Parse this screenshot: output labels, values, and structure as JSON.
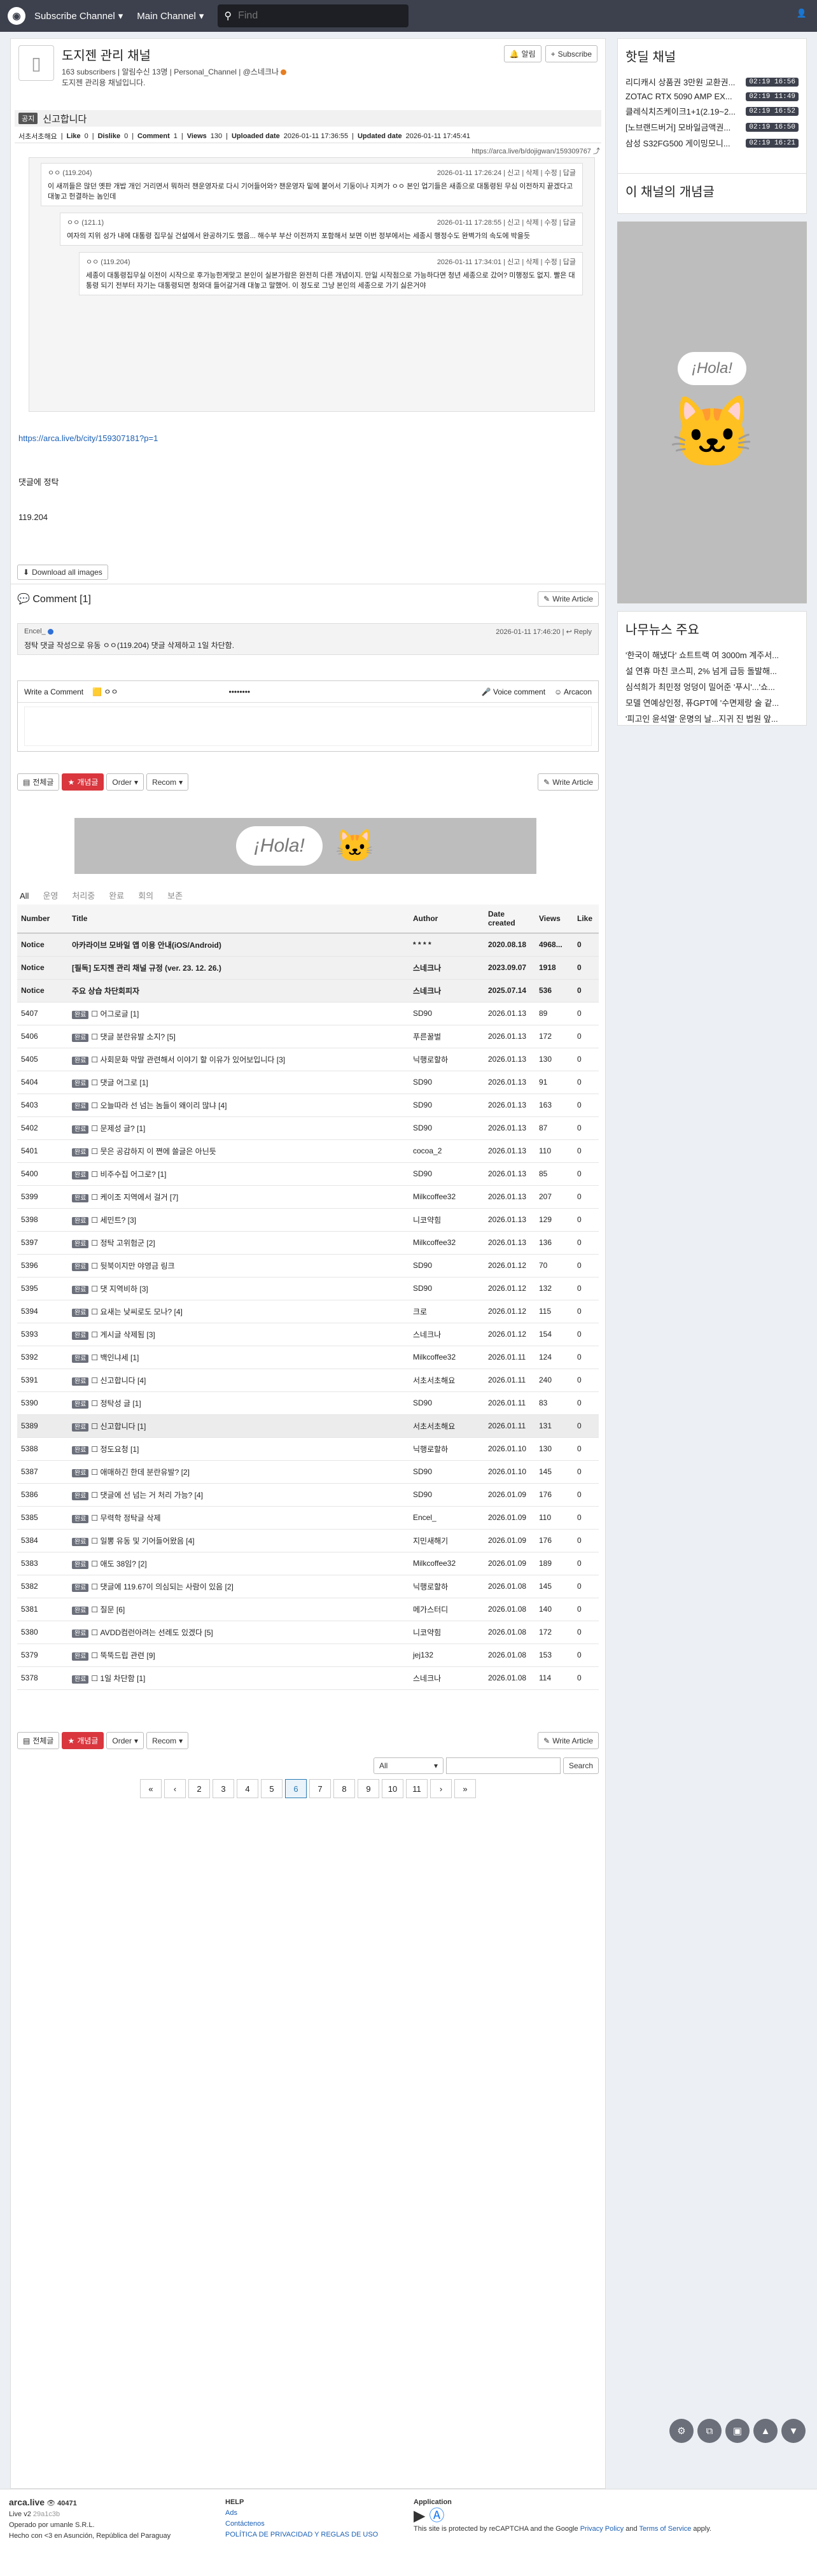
{
  "nav": {
    "subscribe": "Subscribe Channel",
    "main": "Main Channel",
    "search_placeholder": "Find"
  },
  "channel": {
    "name": "도지젠 관리 채널",
    "subs": "163 subscribers",
    "alert": "알림수신 13명",
    "type": "Personal_Channel",
    "owner": "@스네크나",
    "desc": "도지젠 관리용 채널입니다.",
    "notify": "알림",
    "subscribe": "Subscribe"
  },
  "article": {
    "cat": "공지",
    "title": "신고합니다",
    "author": "서초서초해요",
    "like_lbl": "Like",
    "like": "0",
    "dislike_lbl": "Dislike",
    "dislike": "0",
    "comment_lbl": "Comment",
    "comment": "1",
    "views_lbl": "Views",
    "views": "130",
    "up_lbl": "Uploaded date",
    "up": "2026-01-11 17:36:55",
    "upd_lbl": "Updated date",
    "upd": "2026-01-11 17:45:41",
    "link": "https://arca.live/b/dojigwan/159309767"
  },
  "quote": [
    {
      "who": "ㅇㅇ (119.204)",
      "time": "2026-01-11 17:26:24",
      "acts": "신고 | 삭제 | 수정 | 답글",
      "text": "이 새끼들은 많던 옛판 개밥 개인 거리면서 뭐하러 챈운영자로 다시 기어들어와? 챈운영자 밑에 붙어서 기둥이나 지켜가 ㅇㅇ 본인 업기들은 새종으로 대통령된 무심 이전하지 끝겠다고 대놓고 헌결하는 놈인데"
    },
    {
      "who": "ㅇㅇ (121.1)",
      "time": "2026-01-11 17:28:55",
      "acts": "신고 | 삭제 | 수정 | 답글",
      "text": "여자의 지위 성가 내에 대통령 집무실 건설에서 완공하기도 했음... 해수부 부산 이전까지 포함해서 보면 이번 정부에서는 세종시 행정수도 완벽가의 속도에 박을듯"
    },
    {
      "who": "ㅇㅇ (119.204)",
      "time": "2026-01-11 17:34:01",
      "acts": "신고 | 삭제 | 수정 | 답글",
      "text": "세종이 대통령집무실 이전이 시작으로 후가능한게맞고 본인이 실본가람은 완전히 다른 개념이지. 만일 시작점으로 가능하다면 청년 세종으로 갔어? 미행정도 없지. 빨은 대통령 되기 전부터 자기는 대통령되면 청와대 들어갈거래 대놓고 말했어. 이 정도로 그냥 본인의 세종으로 가기 싫은거야"
    }
  ],
  "body": {
    "link": "https://arca.live/b/city/159307181?p=1",
    "line1": "댓글에 정탁",
    "line2": "119.204"
  },
  "download": "Download all images",
  "comments": {
    "title": "Comment [1]",
    "write": "Write Article",
    "author": "Encel_",
    "time": "2026-01-11 17:46:20",
    "reply": "Reply",
    "text": "정탁 댓글 작성으로 유동 ㅇㅇ(119.204) 댓글 삭제하고 1일 차단함.",
    "write_comment": "Write a Comment",
    "nick": "ㅇㅇ",
    "pw": "••••••••",
    "voice": "Voice comment",
    "arcacon": "Arcacon"
  },
  "listbar": {
    "all": "전체글",
    "best": "개념글",
    "order": "Order",
    "recom": "Recom",
    "write": "Write Article"
  },
  "tabs": [
    "All",
    "운영",
    "처리중",
    "완료",
    "회의",
    "보존"
  ],
  "cols": {
    "num": "Number",
    "title": "Title",
    "author": "Author",
    "date": "Date created",
    "views": "Views",
    "like": "Like"
  },
  "rows": [
    {
      "n": "Notice",
      "c": "",
      "t": "아카라이브 모바일 앱 이용 안내(iOS/Android)",
      "a": "* * * *",
      "d": "2020.08.18",
      "v": "4968...",
      "l": "0",
      "k": "notice"
    },
    {
      "n": "Notice",
      "c": "",
      "t": "[필독] 도지젠 관리 채널 규정 (ver. 23. 12. 26.)",
      "a": "스네크나",
      "d": "2023.09.07",
      "v": "1918",
      "l": "0",
      "k": "notice"
    },
    {
      "n": "Notice",
      "c": "",
      "t": "주요 상습 차단회피자",
      "a": "스네크나",
      "d": "2025.07.14",
      "v": "536",
      "l": "0",
      "k": "notice"
    },
    {
      "n": "5407",
      "c": "완료",
      "t": "어그로글 [1]",
      "a": "SD90",
      "d": "2026.01.13",
      "v": "89",
      "l": "0",
      "k": ""
    },
    {
      "n": "5406",
      "c": "완료",
      "t": "댓글 분란유발 소지? [5]",
      "a": "푸른꿀벌",
      "d": "2026.01.13",
      "v": "172",
      "l": "0",
      "k": ""
    },
    {
      "n": "5405",
      "c": "완료",
      "t": "사회문화 막말 관련해서 이야기 할 이유가 있어보입니다 [3]",
      "a": "닉행로할하",
      "d": "2026.01.13",
      "v": "130",
      "l": "0",
      "k": ""
    },
    {
      "n": "5404",
      "c": "완료",
      "t": "댓글 어그로 [1]",
      "a": "SD90",
      "d": "2026.01.13",
      "v": "91",
      "l": "0",
      "k": ""
    },
    {
      "n": "5403",
      "c": "완료",
      "t": "오늘따라 선 넘는 놈들이 왜이리 많냐 [4]",
      "a": "SD90",
      "d": "2026.01.13",
      "v": "163",
      "l": "0",
      "k": ""
    },
    {
      "n": "5402",
      "c": "완료",
      "t": "문제성 글? [1]",
      "a": "SD90",
      "d": "2026.01.13",
      "v": "87",
      "l": "0",
      "k": ""
    },
    {
      "n": "5401",
      "c": "완료",
      "t": "뭇은 공감하지 이 쪈에 쓸글은 아닌듯",
      "a": "cocoa_2",
      "d": "2026.01.13",
      "v": "110",
      "l": "0",
      "k": ""
    },
    {
      "n": "5400",
      "c": "완료",
      "t": "비주수집 어그로? [1]",
      "a": "SD90",
      "d": "2026.01.13",
      "v": "85",
      "l": "0",
      "k": ""
    },
    {
      "n": "5399",
      "c": "완료",
      "t": "케이조 지역에서 걸거 [7]",
      "a": "Milkcoffee32",
      "d": "2026.01.13",
      "v": "207",
      "l": "0",
      "k": ""
    },
    {
      "n": "5398",
      "c": "완료",
      "t": "세민트? [3]",
      "a": "니코약힘",
      "d": "2026.01.13",
      "v": "129",
      "l": "0",
      "k": ""
    },
    {
      "n": "5397",
      "c": "완료",
      "t": "정탁 고위험군 [2]",
      "a": "Milkcoffee32",
      "d": "2026.01.13",
      "v": "136",
      "l": "0",
      "k": ""
    },
    {
      "n": "5396",
      "c": "완료",
      "t": "뒷북이지만 야영금 링크",
      "a": "SD90",
      "d": "2026.01.12",
      "v": "70",
      "l": "0",
      "k": ""
    },
    {
      "n": "5395",
      "c": "완료",
      "t": "댓 지역비하 [3]",
      "a": "SD90",
      "d": "2026.01.12",
      "v": "132",
      "l": "0",
      "k": ""
    },
    {
      "n": "5394",
      "c": "완료",
      "t": "요새는 낮씨로도 모나? [4]",
      "a": "크로",
      "d": "2026.01.12",
      "v": "115",
      "l": "0",
      "k": ""
    },
    {
      "n": "5393",
      "c": "완료",
      "t": "게시글 삭제됨 [3]",
      "a": "스네크나",
      "d": "2026.01.12",
      "v": "154",
      "l": "0",
      "k": ""
    },
    {
      "n": "5392",
      "c": "완료",
      "t": "백인냐세 [1]",
      "a": "Milkcoffee32",
      "d": "2026.01.11",
      "v": "124",
      "l": "0",
      "k": ""
    },
    {
      "n": "5391",
      "c": "완료",
      "t": "신고합니다 [4]",
      "a": "서초서초해요",
      "d": "2026.01.11",
      "v": "240",
      "l": "0",
      "k": ""
    },
    {
      "n": "5390",
      "c": "완료",
      "t": "정탁성 글 [1]",
      "a": "SD90",
      "d": "2026.01.11",
      "v": "83",
      "l": "0",
      "k": ""
    },
    {
      "n": "5389",
      "c": "완료",
      "t": "신고합니다 [1]",
      "a": "서초서초해요",
      "d": "2026.01.11",
      "v": "131",
      "l": "0",
      "k": "hl"
    },
    {
      "n": "5388",
      "c": "완료",
      "t": "정도요청 [1]",
      "a": "닉행로할하",
      "d": "2026.01.10",
      "v": "130",
      "l": "0",
      "k": ""
    },
    {
      "n": "5387",
      "c": "완료",
      "t": "애매하긴 한데 분란유발? [2]",
      "a": "SD90",
      "d": "2026.01.10",
      "v": "145",
      "l": "0",
      "k": ""
    },
    {
      "n": "5386",
      "c": "완료",
      "t": "댓글에 선 넘는 거 처리 가능? [4]",
      "a": "SD90",
      "d": "2026.01.09",
      "v": "176",
      "l": "0",
      "k": ""
    },
    {
      "n": "5385",
      "c": "완료",
      "t": "무력학 정탁글 삭제",
      "a": "Encel_",
      "d": "2026.01.09",
      "v": "110",
      "l": "0",
      "k": ""
    },
    {
      "n": "5384",
      "c": "완료",
      "t": "일뽕 유동 및 기어들어왔음 [4]",
      "a": "지민새해기",
      "d": "2026.01.09",
      "v": "176",
      "l": "0",
      "k": ""
    },
    {
      "n": "5383",
      "c": "완료",
      "t": "애도 38임? [2]",
      "a": "Milkcoffee32",
      "d": "2026.01.09",
      "v": "189",
      "l": "0",
      "k": ""
    },
    {
      "n": "5382",
      "c": "완료",
      "t": "댓글에 119.67이 의심되는 사람이 있음 [2]",
      "a": "닉행로할하",
      "d": "2026.01.08",
      "v": "145",
      "l": "0",
      "k": ""
    },
    {
      "n": "5381",
      "c": "완료",
      "t": "질문 [6]",
      "a": "메가스터디",
      "d": "2026.01.08",
      "v": "140",
      "l": "0",
      "k": ""
    },
    {
      "n": "5380",
      "c": "완료",
      "t": "AVDD컴런아려는 선례도 있겠다 [5]",
      "a": "니코약힘",
      "d": "2026.01.08",
      "v": "172",
      "l": "0",
      "k": ""
    },
    {
      "n": "5379",
      "c": "완료",
      "t": "뚝뚝드립 관련 [9]",
      "a": "jej132",
      "d": "2026.01.08",
      "v": "153",
      "l": "0",
      "k": ""
    },
    {
      "n": "5378",
      "c": "완료",
      "t": "1일 차단함 [1]",
      "a": "스네크나",
      "d": "2026.01.08",
      "v": "114",
      "l": "0",
      "k": ""
    }
  ],
  "search": {
    "scope": "All",
    "btn": "Search"
  },
  "pages": [
    "«",
    "‹",
    "2",
    "3",
    "4",
    "5",
    "6",
    "7",
    "8",
    "9",
    "10",
    "11",
    "›",
    "»"
  ],
  "side": {
    "hot_title": "핫딜 채널",
    "hot": [
      {
        "t": "리디캐시 상품권 3만원 교환권...",
        "time": "02:19 16:56"
      },
      {
        "t": "ZOTAC RTX 5090 AMP EX...",
        "time": "02:19 11:49"
      },
      {
        "t": "클레식치즈케이크1+1(2.19~2...",
        "time": "02:19 16:52"
      },
      {
        "t": "[노브랜드버거] 모바일금액권...",
        "time": "02:19 16:50"
      },
      {
        "t": "삼성 S32FG500 게이밍모니...",
        "time": "02:19 16:21"
      }
    ],
    "best_title": "이 채널의 개념글",
    "news_title": "나무뉴스 주요",
    "news": [
      "'한국이 해냈다' 쇼트트랙 여 3000m 계주서...",
      "설 연휴 마친 코스피, 2% 넘게 급등 돌발해...",
      "심석희가 최민정 엉덩이 밀어준 '푸시'...'쇼...",
      "모델 연예상인정, 퓨GPT에 '수면제랑 술 같...",
      "'피고인 윤석열' 운명의 날...지귀 진 법원 앞..."
    ]
  },
  "footer": {
    "brand": "arca.live",
    "count": "40471",
    "ver": "Live v2",
    "hash": "29a1c3b",
    "op": "Operado por umanle S.R.L.",
    "made": "Hecho con <3 en Asunción, República del Paraguay",
    "help": "HELP",
    "ads": "Ads",
    "contact": "Contáctenos",
    "policy": "POLÍTICA DE PRIVACIDAD Y REGLAS DE USO",
    "app": "Application",
    "recap": "This site is protected by reCAPTCHA and the Google",
    "pp": "Privacy Policy",
    "and": "and",
    "tos": "Terms of Service",
    "apply": "apply."
  }
}
